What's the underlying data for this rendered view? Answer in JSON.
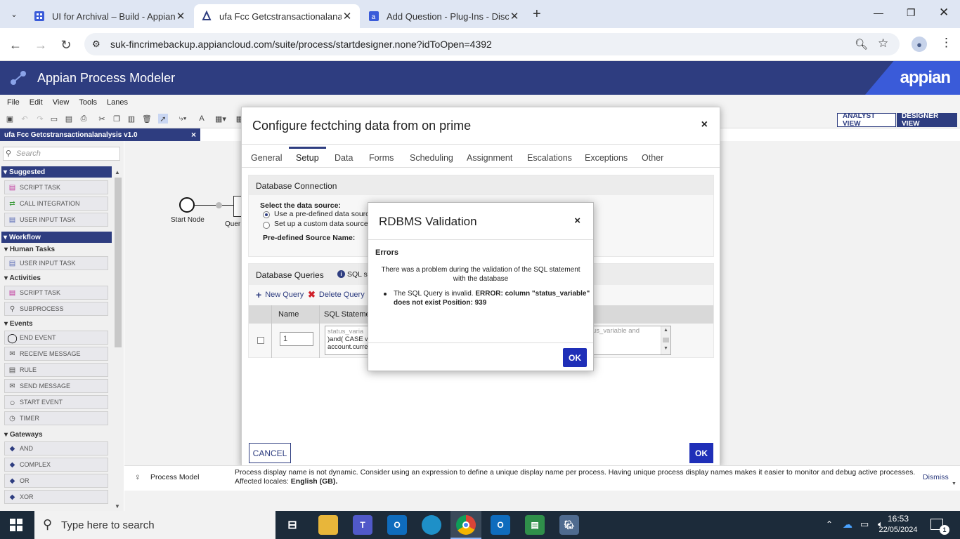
{
  "browser": {
    "tabs": [
      {
        "title": "UI for Archival – Build - Appian",
        "icon": "appian-grid-icon"
      },
      {
        "title": "ufa Fcc Getcstransactionalanalysis",
        "icon": "appian-tab-icon"
      },
      {
        "title": "Add Question - Plug-Ins - Discu",
        "icon": "appian-community-icon"
      }
    ],
    "new_tab": "+",
    "url": "suk-fincrimebackup.appiancloud.com/suite/process/startdesigner.none?idToOpen=4392"
  },
  "app": {
    "title": "Appian Process Modeler",
    "logo_text": "appian",
    "menu": [
      "File",
      "Edit",
      "View",
      "Tools",
      "Lanes"
    ],
    "analyst_view": "ANALYST VIEW",
    "designer_view": "DESIGNER VIEW",
    "model_tab": "ufa Fcc Getcstransactionalanalysis v1.0",
    "model_tab_close": "×"
  },
  "palette": {
    "search_placeholder": "Search",
    "suggested": {
      "label": "Suggested",
      "items": [
        "SCRIPT TASK",
        "CALL INTEGRATION",
        "USER INPUT TASK"
      ]
    },
    "workflow": {
      "label": "Workflow"
    },
    "human_tasks": {
      "label": "Human Tasks",
      "items": [
        "USER INPUT TASK"
      ]
    },
    "activities": {
      "label": "Activities",
      "items": [
        "SCRIPT TASK",
        "SUBPROCESS"
      ]
    },
    "events": {
      "label": "Events",
      "items": [
        "END EVENT",
        "RECEIVE MESSAGE",
        "RULE",
        "SEND MESSAGE",
        "START EVENT",
        "TIMER"
      ]
    },
    "gateways": {
      "label": "Gateways",
      "items": [
        "AND",
        "COMPLEX",
        "OR",
        "XOR"
      ]
    }
  },
  "canvas": {
    "start_node_label": "Start Node",
    "query_node_label": "Quer"
  },
  "config_dialog": {
    "title": "Configure fectching data from on prime",
    "close": "×",
    "tabs": [
      "General",
      "Setup",
      "Data",
      "Forms",
      "Scheduling",
      "Assignment",
      "Escalations",
      "Exceptions",
      "Other"
    ],
    "active_tab": "Setup",
    "db_connection": {
      "header": "Database Connection",
      "select_label": "Select the data source:",
      "option_predefined": "Use a pre-defined data source",
      "option_custom": "Set up a custom data source",
      "predefined_name_label": "Pre-defined Source Name:"
    },
    "db_queries": {
      "header": "Database Queries",
      "sql_info": "SQL sta",
      "new_query": "New Query",
      "delete_query": "Delete Query",
      "col_name": "Name",
      "col_sql": "SQL Statemen",
      "row_name_value": "1",
      "sql_line1": "status_varia",
      "sql_line2": ")and( CASE wh",
      "sql_line3": "account.curre",
      "sql_tail": "us_variable and"
    },
    "cancel": "CANCEL",
    "ok": "OK"
  },
  "validation_dialog": {
    "title": "RDBMS Validation",
    "close": "×",
    "errors_heading": "Errors",
    "message": "There was a problem during the validation of the SQL statement with the database",
    "error_prefix": "The SQL Query is invalid.",
    "error_detail_bold": "ERROR: column \"status_variable\" does not exist Position: 939",
    "ok": "OK"
  },
  "notification": {
    "section": "Process Model",
    "message_part1": "Process display name is not dynamic. Consider using an expression to define a unique display name per process. Having unique process display names makes it easier to monitor and debug active processes. Affected locales:",
    "message_bold": "English (GB).",
    "dismiss": "Dismiss"
  },
  "taskbar": {
    "search_placeholder": "Type here to search",
    "time": "16:53",
    "date": "22/05/2024",
    "notification_count": "1"
  },
  "colors": {
    "appian_navy": "#2e3d80",
    "appian_blue": "#3a5bd9",
    "ok_button": "#1f2fb8",
    "delete_red": "#d0212b"
  }
}
